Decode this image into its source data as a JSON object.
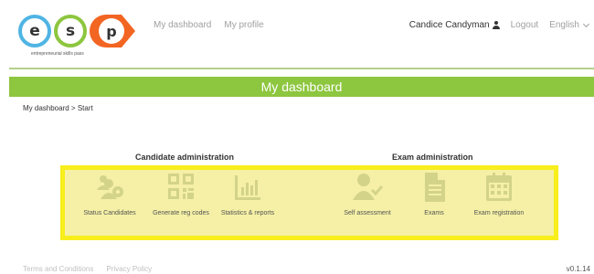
{
  "logo": {
    "letters": [
      "e",
      "s",
      "p"
    ],
    "tagline": "entrepreneurial skills pass"
  },
  "nav": {
    "dashboard": "My dashboard",
    "profile": "My profile"
  },
  "user": {
    "name": "Candice Candyman",
    "logout": "Logout",
    "language": "English"
  },
  "page": {
    "title": "My dashboard",
    "breadcrumb": "My dashboard > Start"
  },
  "candidate_admin": {
    "heading": "Candidate administration",
    "items": [
      {
        "label": "Status Candidates",
        "icon": "users-gear-icon"
      },
      {
        "label": "Generate reg codes",
        "icon": "qr-code-icon"
      },
      {
        "label": "Statistics & reports",
        "icon": "bar-chart-icon"
      }
    ]
  },
  "exam_admin": {
    "heading": "Exam administration",
    "items": [
      {
        "label": "Self assessment",
        "icon": "user-check-icon"
      },
      {
        "label": "Exams",
        "icon": "document-icon"
      },
      {
        "label": "Exam registration",
        "icon": "calendar-icon"
      }
    ]
  },
  "footer": {
    "terms": "Terms and Conditions",
    "privacy": "Privacy Policy",
    "version": "v0.1.14"
  },
  "colors": {
    "accent_green": "#8dc63f",
    "highlight_yellow": "#f7ee1c",
    "icon_tint": "#d3d38a"
  }
}
